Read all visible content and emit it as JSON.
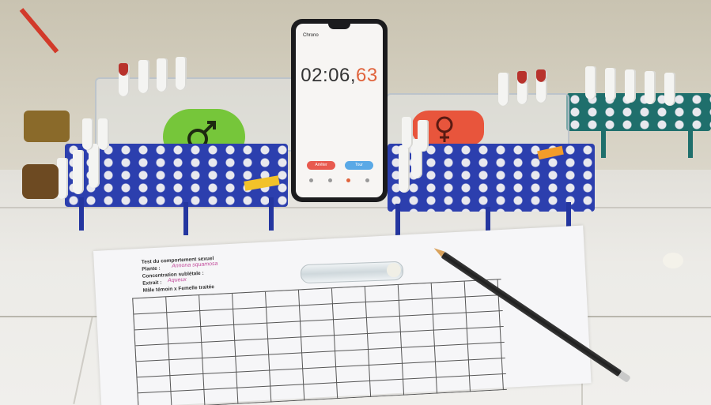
{
  "stopwatch": {
    "app_title": "Chrono",
    "time_main": "02:06,",
    "time_centis": "63",
    "reset_label": "Arrêter",
    "lap_label": "Tour"
  },
  "worksheet": {
    "title": "Test du comportement sexuel",
    "plant_label": "Plante :",
    "plant_value": "Annona squamosa",
    "concentration_label": "Concentration sublétale :",
    "extract_label": "Extrait :",
    "extract_value": "Aqueux",
    "pair_label": "Mâle témoin x Femelle traitée"
  },
  "colors": {
    "rack_blue": "#2c3fae",
    "sticker_green": "#76c63a",
    "sticker_red": "#e8553c",
    "label_orange": "#f29c2a",
    "timer_accent": "#e0633c",
    "button_red": "#e85a4f",
    "button_blue": "#5aa9e6"
  },
  "icons": {
    "male_symbol": "male-icon",
    "female_symbol": "female-icon"
  }
}
